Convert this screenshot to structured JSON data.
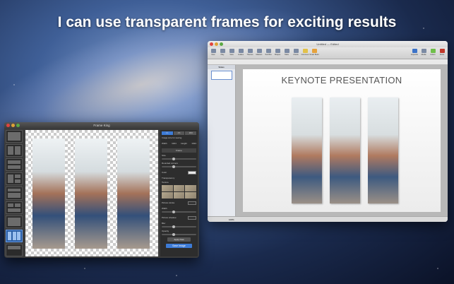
{
  "headline": "I can use transparent frames for exciting results",
  "keynote": {
    "window_title": "Untitled — Edited",
    "toolbar": [
      "New",
      "Play",
      "View",
      "Guides",
      "Themes",
      "Masters",
      "Text Box",
      "Shapes",
      "Table",
      "Charts",
      "Comment",
      "Smart Build",
      "Inspector",
      "Media",
      "Colors",
      "Fonts"
    ],
    "slides_header": "Slides",
    "slide_title": "KEYNOTE PRESENTATION",
    "zoom": "100%"
  },
  "frameking": {
    "window_title": "Frame King",
    "tabs": [
      "1:1",
      "4:3",
      "16:9"
    ],
    "size_label": "Image size for saving",
    "width_label": "Width",
    "width_value": "1024",
    "height_label": "Height",
    "height_value": "1024",
    "section_frame": "Frame",
    "size": "Size",
    "rounded": "Rounded corners",
    "color": "Color",
    "transparency": "Transparency",
    "texture": "Texture",
    "picture_stroke": "Picture stroke",
    "width_small": "Width",
    "picture_shadow": "Picture shadow",
    "blur": "Blur",
    "opacity": "Opacity",
    "apply_button": "Apply Now",
    "save_button": "Save Image"
  }
}
